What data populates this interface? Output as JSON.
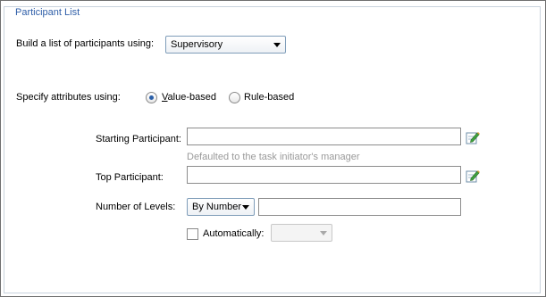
{
  "section": {
    "title": "Participant List"
  },
  "build": {
    "label": "Build a list of participants using:",
    "selected": "Supervisory"
  },
  "attributes": {
    "label": "Specify attributes using:",
    "value_based": {
      "mnemonic": "V",
      "rest": "alue-based",
      "checked": true
    },
    "rule_based": {
      "label": "Rule-based",
      "checked": false
    }
  },
  "starting": {
    "label": "Starting Participant:",
    "value": "",
    "hint": "Defaulted to the task initiator's manager"
  },
  "top": {
    "label": "Top Participant:",
    "value": ""
  },
  "levels": {
    "label": "Number of Levels:",
    "mode": "By Number",
    "value": ""
  },
  "automatically": {
    "label": "Automatically:",
    "checked": false,
    "selected": ""
  },
  "icons": {
    "edit": "edit-pencil-icon"
  }
}
